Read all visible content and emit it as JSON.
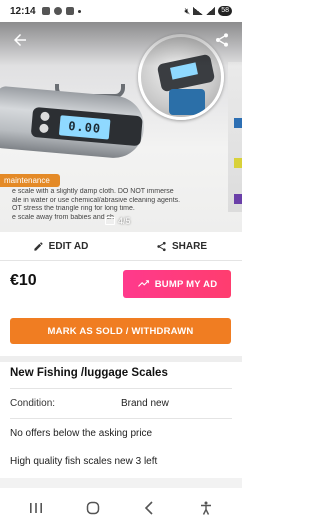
{
  "status_bar": {
    "time": "12:14",
    "battery": "58"
  },
  "hero": {
    "scale_display": "0.00",
    "maintenance_label": "maintenance",
    "maintenance_lines": [
      "e scale with a slightly damp cloth. DO NOT immerse",
      "ale in water or use chemical/abrasive cleaning agents.",
      "OT stress the triangle ring for long time.",
      "e scale away from babies and ch"
    ],
    "photo_counter": "4/5"
  },
  "actions": {
    "edit_label": "EDIT AD",
    "share_label": "SHARE"
  },
  "listing": {
    "price": "€10",
    "bump_label": "BUMP MY AD",
    "sold_label": "MARK AS SOLD / WITHDRAWN",
    "title": "New Fishing /luggage Scales",
    "condition_label": "Condition:",
    "condition_value": "Brand new",
    "description": [
      "No offers below the asking price",
      "High quality fish scales new 3 left"
    ]
  },
  "colors": {
    "bump_pink": "#ff3a8c",
    "sold_orange": "#f07d22",
    "maintenance_orange": "#e48a27"
  }
}
